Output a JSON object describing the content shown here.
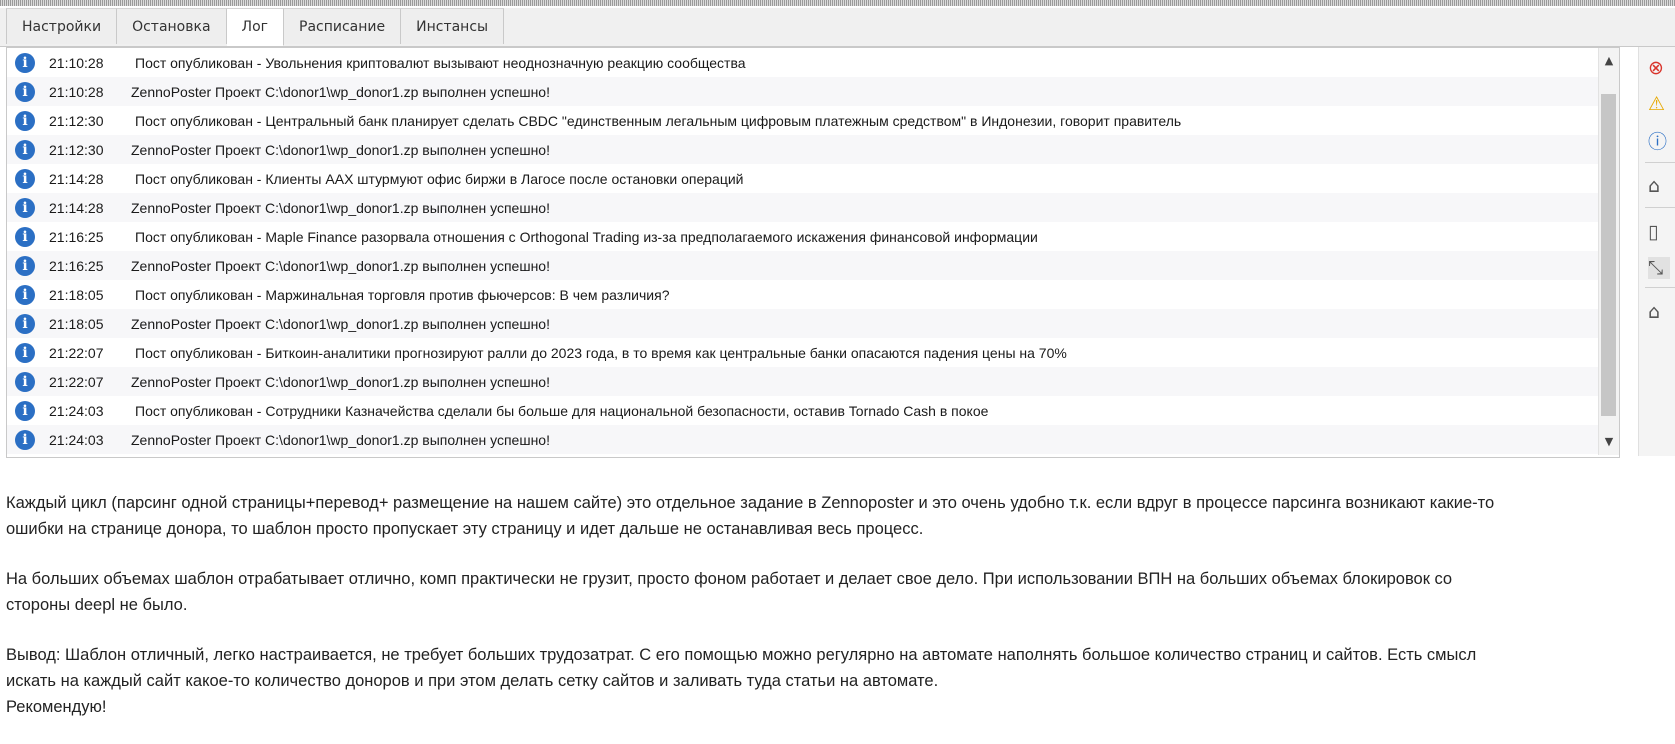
{
  "tabs": [
    {
      "label": "Настройки"
    },
    {
      "label": "Остановка"
    },
    {
      "label": "Лог"
    },
    {
      "label": "Расписание"
    },
    {
      "label": "Инстансы"
    }
  ],
  "log": {
    "rows": [
      {
        "time": "21:10:28",
        "text": "Пост опубликован - Увольнения криптовалют вызывают неоднозначную реакцию сообщества"
      },
      {
        "time": "21:10:28",
        "text": "ZennoPoster Проект C:\\donor1\\wp_donor1.zp выполнен успешно!"
      },
      {
        "time": "21:12:30",
        "text": "Пост опубликован - Центральный банк планирует сделать CBDC \"единственным легальным цифровым платежным средством\" в Индонезии, говорит правитель"
      },
      {
        "time": "21:12:30",
        "text": "ZennoPoster Проект C:\\donor1\\wp_donor1.zp выполнен успешно!"
      },
      {
        "time": "21:14:28",
        "text": "Пост опубликован - Клиенты AAX штурмуют офис биржи в Лагосе после остановки операций"
      },
      {
        "time": "21:14:28",
        "text": "ZennoPoster Проект C:\\donor1\\wp_donor1.zp выполнен успешно!"
      },
      {
        "time": "21:16:25",
        "text": "Пост опубликован - Maple Finance разорвала отношения с Orthogonal Trading из-за предполагаемого искажения финансовой информации"
      },
      {
        "time": "21:16:25",
        "text": "ZennoPoster Проект C:\\donor1\\wp_donor1.zp выполнен успешно!"
      },
      {
        "time": "21:18:05",
        "text": "Пост опубликован - Маржинальная торговля против фьючерсов: В чем различия?"
      },
      {
        "time": "21:18:05",
        "text": "ZennoPoster Проект C:\\donor1\\wp_donor1.zp выполнен успешно!"
      },
      {
        "time": "21:22:07",
        "text": "Пост опубликован - Биткоин-аналитики прогнозируют ралли до 2023 года, в то время как центральные банки опасаются падения цены на 70%"
      },
      {
        "time": "21:22:07",
        "text": "ZennoPoster Проект C:\\donor1\\wp_donor1.zp выполнен успешно!"
      },
      {
        "time": "21:24:03",
        "text": "Пост опубликован - Сотрудники Казначейства сделали бы больше для национальной безопасности, оставив Tornado Cash в покое"
      },
      {
        "time": "21:24:03",
        "text": "ZennoPoster Проект C:\\donor1\\wp_donor1.zp выполнен успешно!"
      }
    ]
  },
  "scroll": {
    "up": "▲",
    "down": "▼"
  },
  "toolbar_icons": [
    "error-filter-icon",
    "warning-filter-icon",
    "info-filter-icon",
    "tag-icon",
    "clipboard-icon",
    "resize-icon",
    "tag-alt-icon"
  ],
  "article": {
    "p1_line1": "Каждый цикл (парсинг одной страницы+перевод+ размещение на нашем сайте) это отдельное задание в Zennoposter и это очень удобно т.к. если вдруг в процессе парсинга возникают какие-то",
    "p1_line2": "ошибки на странице донора, то шаблон просто пропускает эту страницу и идет дальше не останавливая весь процесс.",
    "p2_line1": "На больших объемах шаблон отрабатывает отлично, комп практически не грузит, просто фоном работает и делает свое дело. При использовании ВПН на больших объемах блокировок со",
    "p2_line2": "стороны deepl не было.",
    "p3_line1": "Вывод: Шаблон отличный, легко настраивается, не требует больших трудозатрат. С его помощью можно регулярно на автомате наполнять большое количество страниц и сайтов. Есть смысл",
    "p3_line2": "искать на каждый сайт какое-то количество доноров и при этом делать сетку сайтов и заливать туда статьи на автомате.",
    "p3_line3": "Рекомендую!"
  }
}
